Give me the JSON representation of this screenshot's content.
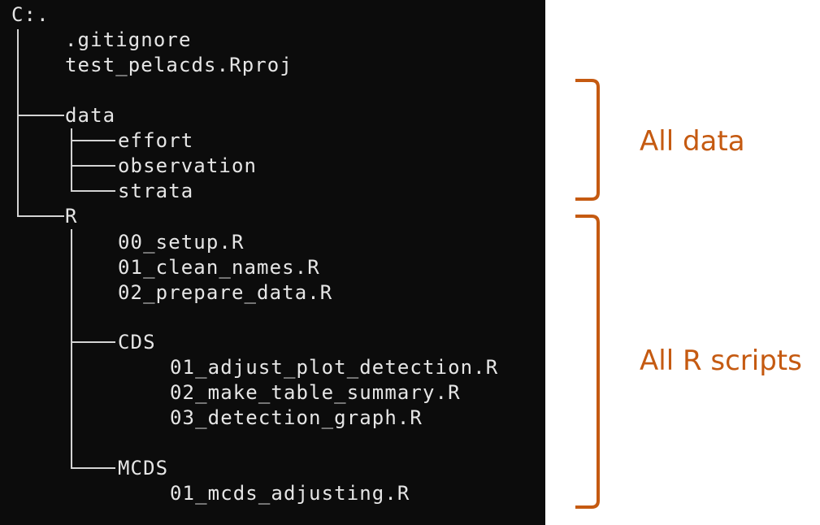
{
  "terminal": {
    "root": "C:.",
    "root_files": [
      ".gitignore",
      "test_pelacds.Rproj"
    ],
    "data": {
      "label": "data",
      "children": [
        "effort",
        "observation",
        "strata"
      ]
    },
    "r": {
      "label": "R",
      "files": [
        "00_setup.R",
        "01_clean_names.R",
        "02_prepare_data.R"
      ],
      "cds": {
        "label": "CDS",
        "files": [
          "01_adjust_plot_detection.R",
          "02_make_table_summary.R",
          "03_detection_graph.R"
        ]
      },
      "mcds": {
        "label": "MCDS",
        "files": [
          "01_mcds_adjusting.R"
        ]
      }
    }
  },
  "annotations": {
    "data_label": "All data",
    "r_label": "All R scripts",
    "color": "#c55a11"
  },
  "colors": {
    "terminal_bg": "#0c0c0c",
    "terminal_text": "#e6e6e6"
  }
}
